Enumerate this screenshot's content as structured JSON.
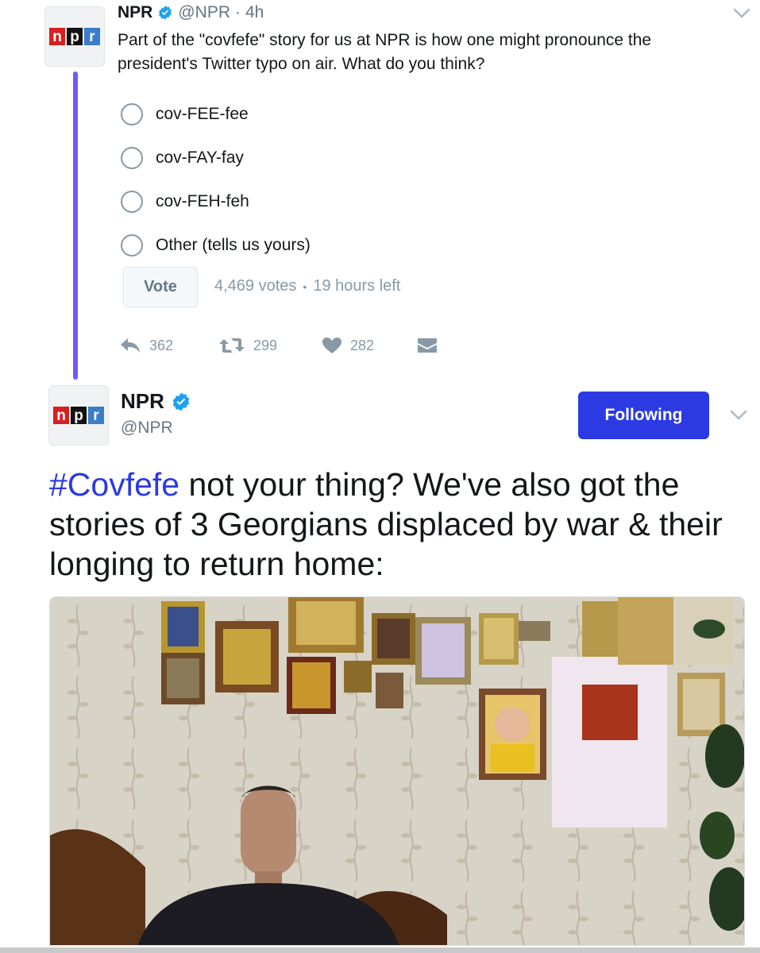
{
  "tweet1": {
    "name": "NPR",
    "handle": "@NPR",
    "separator": "·",
    "time": "4h",
    "text": "Part of the \"covfefe\" story for us at NPR is how one might pronounce the president's Twitter typo on air. What do you think?",
    "poll": {
      "options": [
        "cov-FEE-fee",
        "cov-FAY-fay",
        "cov-FEH-feh",
        "Other (tells us yours)"
      ],
      "vote_label": "Vote",
      "votes": "4,469 votes",
      "dot": "•",
      "time_left": "19 hours left"
    },
    "actions": {
      "replies": "362",
      "retweets": "299",
      "likes": "282"
    }
  },
  "tweet2": {
    "name": "NPR",
    "handle": "@NPR",
    "follow_label": "Following",
    "hashtag": "#Covfefe",
    "text": " not your thing? We've also got the stories of 3 Georgians displaced by war & their longing to return home:"
  },
  "logo": {
    "letters": [
      "n",
      "p",
      "r"
    ]
  },
  "colors": {
    "accent": "#2b3ae3",
    "thread": "#6b5cf6",
    "verified": "#1da1f2",
    "muted": "#8899a6"
  },
  "icons": [
    "npr-logo",
    "verified-icon",
    "chevron-down-icon",
    "reply-icon",
    "retweet-icon",
    "heart-icon",
    "dm-icon"
  ]
}
